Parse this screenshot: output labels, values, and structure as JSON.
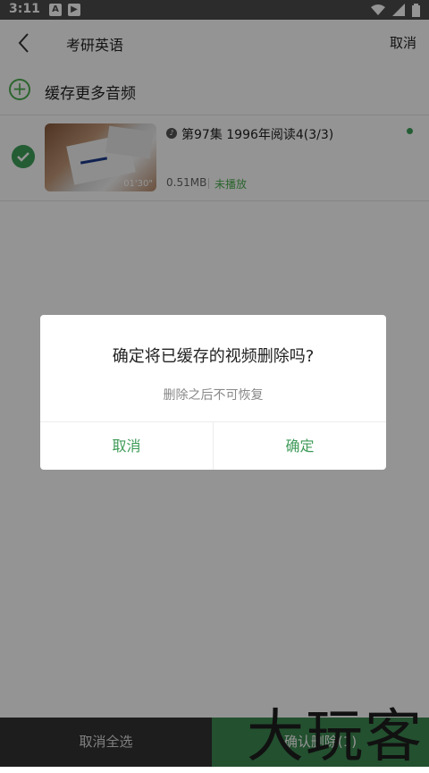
{
  "status_bar": {
    "time": "3:11",
    "icons": [
      "a-icon",
      "play-icon",
      "wifi-icon",
      "signal-icon",
      "battery-icon"
    ]
  },
  "header": {
    "title": "考研英语",
    "cancel_label": "取消"
  },
  "cache_more": {
    "label": "缓存更多音频"
  },
  "item": {
    "title": "第97集 1996年阅读4(3/3)",
    "duration": "01'30\"",
    "size": "0.51MB",
    "status": "未播放"
  },
  "bottom_bar": {
    "select_all_label": "取消全选",
    "confirm_label": "确认删除(1)"
  },
  "dialog": {
    "title": "确定将已缓存的视频删除吗?",
    "message": "删除之后不可恢复",
    "cancel_label": "取消",
    "ok_label": "确定"
  },
  "watermark": "大玩客",
  "colors": {
    "accent": "#3d9a58",
    "overlay": "rgba(0,0,0,0.42)"
  }
}
